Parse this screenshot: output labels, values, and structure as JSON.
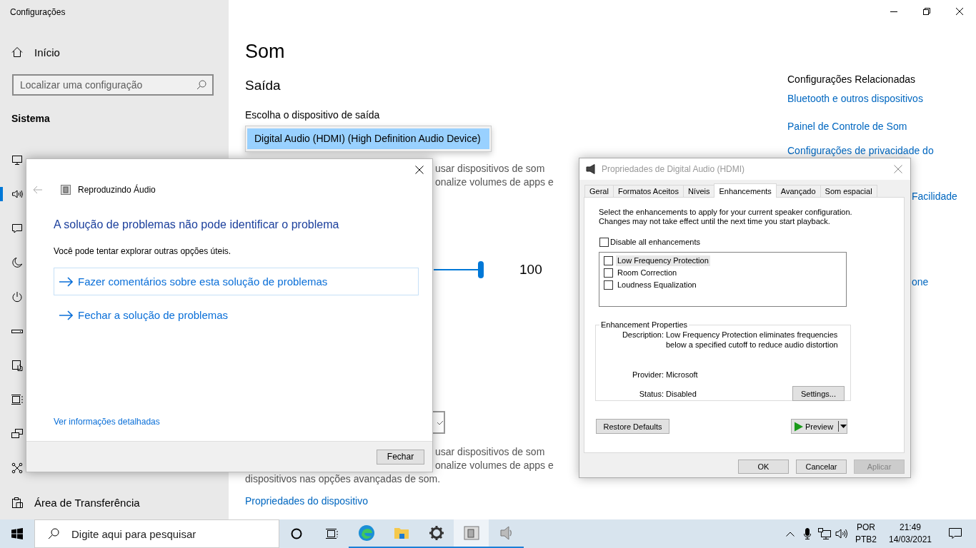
{
  "settings": {
    "title": "Configurações",
    "home": "Início",
    "search": {
      "placeholder": "Localizar uma configuração"
    },
    "section": "Sistema",
    "nav_items": [
      {
        "kind": "display",
        "selected": false
      },
      {
        "kind": "sound",
        "selected": true
      },
      {
        "kind": "notifications",
        "selected": false
      },
      {
        "kind": "focus",
        "selected": false
      },
      {
        "kind": "power",
        "selected": false
      },
      {
        "kind": "storage",
        "selected": false
      },
      {
        "kind": "tablet",
        "selected": false
      },
      {
        "kind": "multitasking",
        "selected": false
      },
      {
        "kind": "projecting",
        "selected": false
      },
      {
        "kind": "shared",
        "selected": false
      },
      {
        "kind": "clipboard",
        "selected": false,
        "label": "Área de Transferência"
      }
    ],
    "page_title": "Som",
    "output": {
      "heading": "Saída",
      "device_label": "Escolha o dispositivo de saída",
      "device_options": [
        {
          "label": "Digital Audio (HDMI) (High Definition Audio Device)",
          "selected": true
        }
      ],
      "partial_text": [
        "usar dispositivos de som",
        "onalize volumes de apps e"
      ],
      "volume": {
        "level": 1,
        "reading": "100"
      }
    },
    "input": {
      "partial_text": [
        "usar dispositivos de som",
        "onalize volumes de apps e"
      ],
      "text": "dispositivos nas opções avançadas de som.",
      "properties_link": "Propriedades do dispositivo"
    },
    "related": {
      "heading": "Configurações Relacionadas",
      "links": [
        "Bluetooth e outros dispositivos",
        "Painel de Controle de Som",
        "Configurações de privacidade do"
      ],
      "partial_links": [
        "Facilidade",
        "one"
      ]
    }
  },
  "troubleshooter": {
    "title": "Reproduzindo Áudio",
    "heading": "A solução de problemas não pode identificar o problema",
    "text": "Você pode tentar explorar outras opções úteis.",
    "options": [
      {
        "label": "Fazer comentários sobre esta solução de problemas",
        "selected": true
      },
      {
        "label": "Fechar a solução de problemas",
        "selected": false
      }
    ],
    "details_link": "Ver informações detalhadas",
    "close_button": "Fechar"
  },
  "properties": {
    "title": "Propriedades de Digital Audio (HDMI)",
    "tabs": [
      {
        "label": "Geral",
        "selected": false
      },
      {
        "label": "Formatos Aceitos",
        "selected": false
      },
      {
        "label": "Níveis",
        "selected": false
      },
      {
        "label": "Enhancements",
        "selected": true
      },
      {
        "label": "Avançado",
        "selected": false
      },
      {
        "label": "Som espacial",
        "selected": false
      }
    ],
    "intro": "Select the enhancements to apply for your current speaker configuration. Changes may not take effect until the next time you start playback.",
    "disable_all": {
      "label": "Disable all enhancements",
      "checked": false
    },
    "enhancements": [
      {
        "label": "Low Frequency Protection",
        "checked": false,
        "selected": true
      },
      {
        "label": "Room Correction",
        "checked": false,
        "selected": false
      },
      {
        "label": "Loudness Equalization",
        "checked": false,
        "selected": false
      }
    ],
    "group": {
      "title": "Enhancement Properties",
      "description_label": "Description:",
      "description": "Low Frequency Protection eliminates frequencies below a specified cutoff to reduce audio distortion",
      "provider_label": "Provider:",
      "provider": "Microsoft",
      "status_label": "Status:",
      "status": "Disabled",
      "settings_button": "Settings..."
    },
    "restore_button": "Restore Defaults",
    "preview_button": "Preview",
    "buttons": [
      {
        "label": "OK",
        "disabled": false
      },
      {
        "label": "Cancelar",
        "disabled": false
      },
      {
        "label": "Aplicar",
        "disabled": true
      }
    ]
  },
  "taskbar": {
    "search_placeholder": "Digite aqui para pesquisar",
    "apps": [
      {
        "kind": "edge",
        "active": false
      },
      {
        "kind": "folder",
        "active": false
      },
      {
        "kind": "gear",
        "active": false
      },
      {
        "kind": "troubleshooter",
        "active": true
      },
      {
        "kind": "speaker",
        "active": false
      }
    ],
    "language": "POR",
    "layout": "PTB2",
    "time": "21:49",
    "date": "14/03/2021"
  }
}
